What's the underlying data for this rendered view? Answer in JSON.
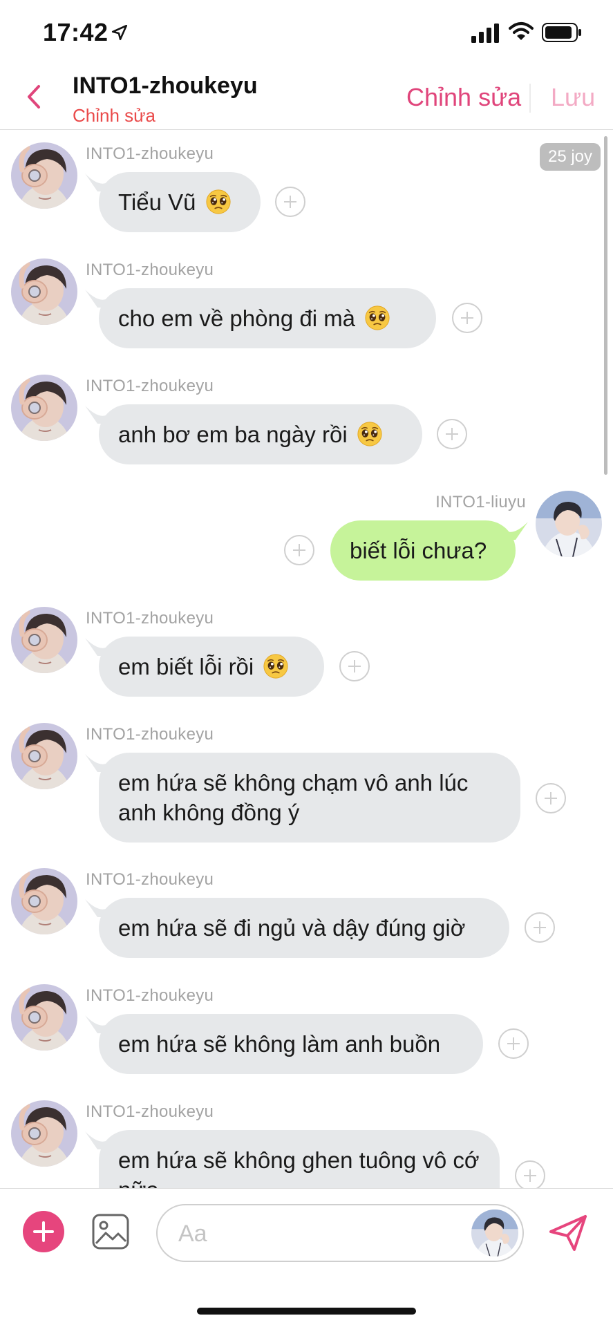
{
  "status_bar": {
    "time": "17:42"
  },
  "header": {
    "title": "INTO1-zhoukeyu",
    "subtitle": "Chỉnh sửa",
    "edit_label": "Chỉnh sửa",
    "save_label": "Lưu"
  },
  "time_badge": "25 joy",
  "messages": [
    {
      "side": "left",
      "sender": "INTO1-zhoukeyu",
      "text": "Tiểu Vũ",
      "emoji": "pleading-face"
    },
    {
      "side": "left",
      "sender": "INTO1-zhoukeyu",
      "text": "cho em về phòng đi mà",
      "emoji": "pleading-face"
    },
    {
      "side": "left",
      "sender": "INTO1-zhoukeyu",
      "text": "anh bơ em ba ngày rồi",
      "emoji": "pleading-face"
    },
    {
      "side": "right",
      "sender": "INTO1-liuyu",
      "text": "biết lỗi chưa?"
    },
    {
      "side": "left",
      "sender": "INTO1-zhoukeyu",
      "text": "em biết lỗi rồi",
      "emoji": "pleading-face"
    },
    {
      "side": "left",
      "sender": "INTO1-zhoukeyu",
      "text": "em hứa sẽ không chạm vô anh lúc anh không đồng ý"
    },
    {
      "side": "left",
      "sender": "INTO1-zhoukeyu",
      "text": "em hứa sẽ đi ngủ và dậy đúng giờ"
    },
    {
      "side": "left",
      "sender": "INTO1-zhoukeyu",
      "text": "em hứa sẽ không làm anh buồn"
    },
    {
      "side": "left",
      "sender": "INTO1-zhoukeyu",
      "text": "em hứa sẽ không ghen tuông vô cớ nữa"
    }
  ],
  "input": {
    "placeholder": "Aa"
  },
  "colors": {
    "accent": "#e6457d",
    "save_disabled": "#f3aac4",
    "subtitle": "#ea4a4a",
    "bubble_left": "#e6e8ea",
    "bubble_right": "#c6f39a",
    "time_badge": "#bdbdbd"
  },
  "icons": {
    "back": "chevron-left-icon",
    "add": "plus-circle-icon",
    "image": "image-icon",
    "send": "send-icon",
    "reaction": "plus-icon",
    "emoji": "pleading-face-emoji"
  }
}
